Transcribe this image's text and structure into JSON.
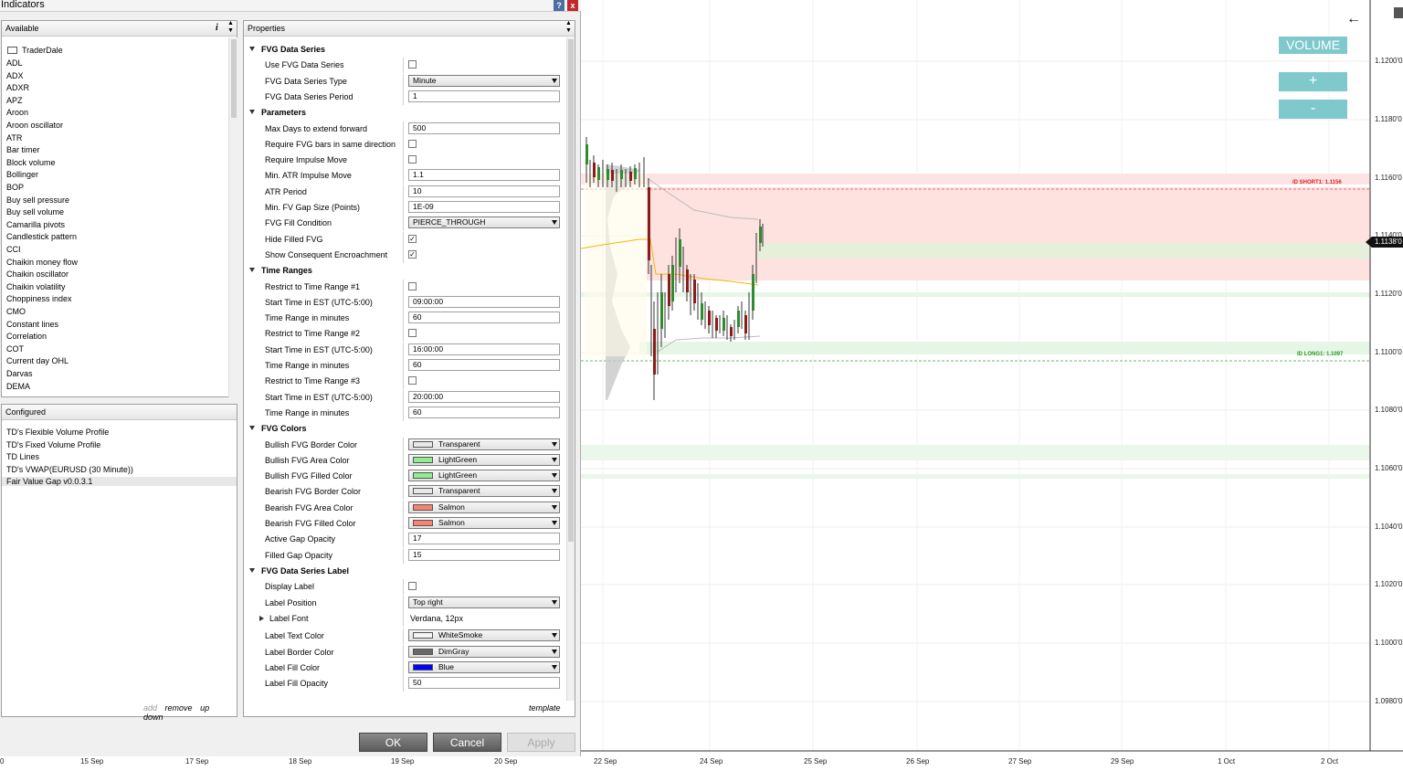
{
  "window": {
    "title": "Indicators",
    "help_label": "?",
    "close_label": "x"
  },
  "available": {
    "header": "Available",
    "info_label": "i",
    "folder": "TraderDale",
    "items": [
      "ADL",
      "ADX",
      "ADXR",
      "APZ",
      "Aroon",
      "Aroon oscillator",
      "ATR",
      "Bar timer",
      "Block volume",
      "Bollinger",
      "BOP",
      "Buy sell pressure",
      "Buy sell volume",
      "Camarilla pivots",
      "Candlestick pattern",
      "CCI",
      "Chaikin money flow",
      "Chaikin oscillator",
      "Chaikin volatility",
      "Choppiness index",
      "CMO",
      "Constant lines",
      "Correlation",
      "COT",
      "Current day OHL",
      "Darvas",
      "DEMA"
    ]
  },
  "configured": {
    "header": "Configured",
    "items": [
      "TD's Flexible Volume Profile",
      "TD's Fixed Volume Profile",
      "TD Lines",
      "TD's VWAP(EURUSD (30 Minute))",
      "Fair Value Gap v0.0.3.1"
    ],
    "actions": {
      "add": "add",
      "remove": "remove",
      "up": "up",
      "down": "down"
    }
  },
  "properties": {
    "header": "Properties",
    "template_label": "template",
    "sections": [
      {
        "title": "FVG Data Series",
        "rows": [
          {
            "label": "Use FVG Data Series",
            "type": "check",
            "checked": false
          },
          {
            "label": "FVG Data Series Type",
            "type": "select",
            "value": "Minute"
          },
          {
            "label": "FVG Data Series Period",
            "type": "text",
            "value": "1"
          }
        ]
      },
      {
        "title": "Parameters",
        "rows": [
          {
            "label": "Max Days to extend forward",
            "type": "text",
            "value": "500"
          },
          {
            "label": "Require FVG bars in same direction",
            "type": "check",
            "checked": false
          },
          {
            "label": "Require Impulse Move",
            "type": "check",
            "checked": false
          },
          {
            "label": "Min. ATR Impulse Move",
            "type": "text",
            "value": "1.1"
          },
          {
            "label": "ATR Period",
            "type": "text",
            "value": "10"
          },
          {
            "label": "Min. FV Gap Size (Points)",
            "type": "text",
            "value": "1E-09"
          },
          {
            "label": "FVG Fill Condition",
            "type": "select",
            "value": "PIERCE_THROUGH"
          },
          {
            "label": "Hide Filled FVG",
            "type": "check",
            "checked": true
          },
          {
            "label": "Show Consequent Encroachment",
            "type": "check",
            "checked": true
          }
        ]
      },
      {
        "title": "Time Ranges",
        "rows": [
          {
            "label": "Restrict to Time Range #1",
            "type": "check",
            "checked": false
          },
          {
            "label": "Start Time in EST (UTC-5:00)",
            "type": "text",
            "value": "09:00:00"
          },
          {
            "label": "Time Range in minutes",
            "type": "text",
            "value": "60"
          },
          {
            "label": "Restrict to Time Range #2",
            "type": "check",
            "checked": false
          },
          {
            "label": "Start Time in EST (UTC-5:00)",
            "type": "text",
            "value": "16:00:00"
          },
          {
            "label": "Time Range in minutes",
            "type": "text",
            "value": "60"
          },
          {
            "label": "Restrict to Time Range #3",
            "type": "check",
            "checked": false
          },
          {
            "label": "Start Time in EST (UTC-5:00)",
            "type": "text",
            "value": "20:00:00"
          },
          {
            "label": "Time Range in minutes",
            "type": "text",
            "value": "60"
          }
        ]
      },
      {
        "title": "FVG Colors",
        "rows": [
          {
            "label": "Bullish FVG Border Color",
            "type": "color",
            "value": "Transparent",
            "swatch": "#e8e8e8"
          },
          {
            "label": "Bullish FVG Area Color",
            "type": "color",
            "value": "LightGreen",
            "swatch": "#90ee90"
          },
          {
            "label": "Bullish FVG Filled Color",
            "type": "color",
            "value": "LightGreen",
            "swatch": "#90ee90"
          },
          {
            "label": "Bearish FVG Border Color",
            "type": "color",
            "value": "Transparent",
            "swatch": "#e8e8e8"
          },
          {
            "label": "Bearish FVG Area Color",
            "type": "color",
            "value": "Salmon",
            "swatch": "#fa8072"
          },
          {
            "label": "Bearish FVG Filled Color",
            "type": "color",
            "value": "Salmon",
            "swatch": "#fa8072"
          },
          {
            "label": "Active Gap Opacity",
            "type": "text",
            "value": "17"
          },
          {
            "label": "Filled Gap Opacity",
            "type": "text",
            "value": "15"
          }
        ]
      },
      {
        "title": "FVG Data Series Label",
        "rows": [
          {
            "label": "Display Label",
            "type": "check",
            "checked": false
          },
          {
            "label": "Label Position",
            "type": "select",
            "value": "Top right"
          },
          {
            "label": "Label Font",
            "type": "font",
            "value": "Verdana, 12px"
          },
          {
            "label": "Label Text Color",
            "type": "color",
            "value": "WhiteSmoke",
            "swatch": "#f5f5f5"
          },
          {
            "label": "Label Border Color",
            "type": "color",
            "value": "DimGray",
            "swatch": "#696969"
          },
          {
            "label": "Label Fill Color",
            "type": "color",
            "value": "Blue",
            "swatch": "#0000ff"
          },
          {
            "label": "Label Fill Opacity",
            "type": "text",
            "value": "50"
          }
        ]
      }
    ]
  },
  "buttons": {
    "ok": "OK",
    "cancel": "Cancel",
    "apply": "Apply"
  },
  "chart": {
    "volume_label": "VOLUME",
    "plus_label": "+",
    "minus_label": "-",
    "price_ticks": [
      "1.1200'0",
      "1.1180'0",
      "1.1160'0",
      "1.1140'0",
      "1.1120'0",
      "1.1100'0",
      "1.1080'0",
      "1.1060'0",
      "1.1040'0",
      "1.1020'0",
      "1.1000'0",
      "1.0980'0"
    ],
    "current_price": "1.1138'0",
    "id_short": "ID SHORT1: 1.1156",
    "id_long": "ID LONG1: 1.1097",
    "dates_left": [
      "0",
      "15 Sep",
      "17 Sep",
      "18 Sep",
      "19 Sep",
      "20 Sep"
    ],
    "dates_right": [
      "22 Sep",
      "24 Sep",
      "25 Sep",
      "26 Sep",
      "27 Sep",
      "29 Sep",
      "1 Oct",
      "2 Oct"
    ],
    "colors": {
      "short": "#e02020",
      "long": "#20a020",
      "volume_btn": "#7fc9cd"
    }
  }
}
